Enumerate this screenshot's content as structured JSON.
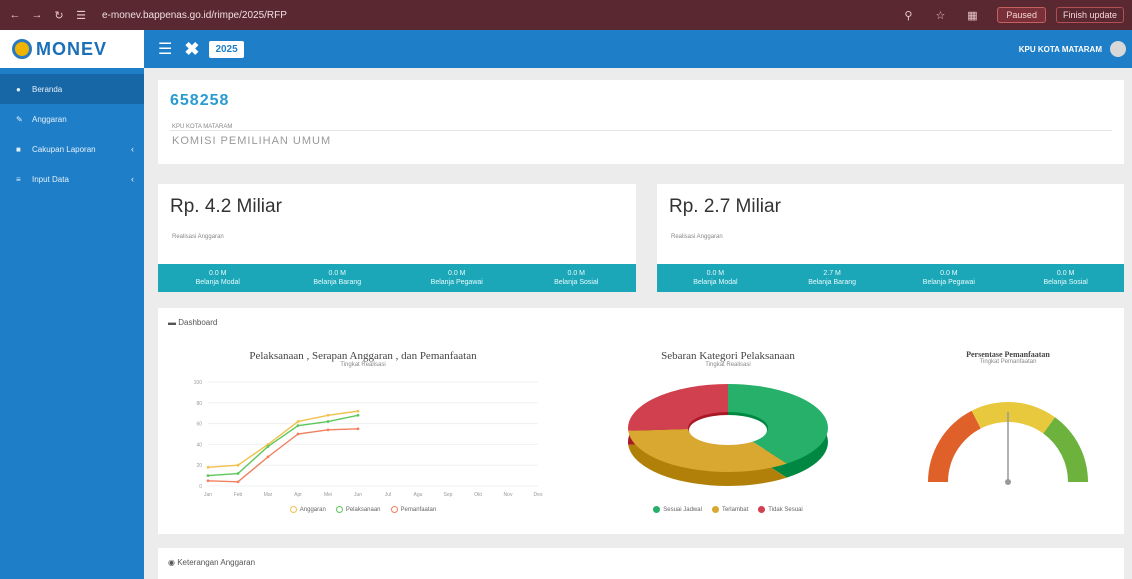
{
  "browser": {
    "url": "e-monev.bappenas.go.id/rimpe/2025/RFP",
    "pill1": "Paused",
    "pill2": "Finish update"
  },
  "app": {
    "logo_text": "MONEV",
    "year": "2025",
    "user": "KPU KOTA MATARAM"
  },
  "sidebar": {
    "items": [
      {
        "label": "Beranda",
        "icon": "home-icon",
        "active": true,
        "chevron": false
      },
      {
        "label": "Anggaran",
        "icon": "pencil-icon",
        "active": false,
        "chevron": false
      },
      {
        "label": "Cakupan Laporan",
        "icon": "folder-icon",
        "active": false,
        "chevron": true
      },
      {
        "label": "Input Data",
        "icon": "list-icon",
        "active": false,
        "chevron": true
      }
    ]
  },
  "header_card": {
    "code": "658258",
    "caption": "KPU KOTA MATARAM",
    "org": "KOMISI PEMILIHAN UMUM"
  },
  "budget_left": {
    "amount": "Rp. 4.2 Miliar",
    "caption": "Realisasi Anggaran",
    "cells": [
      {
        "value": "0.0 M",
        "label": "Belanja Modal"
      },
      {
        "value": "0.0 M",
        "label": "Belanja Barang"
      },
      {
        "value": "0.0 M",
        "label": "Belanja Pegawai"
      },
      {
        "value": "0.0 M",
        "label": "Belanja Sosial"
      }
    ]
  },
  "budget_right": {
    "amount": "Rp. 2.7 Miliar",
    "caption": "Realisasi Anggaran",
    "cells": [
      {
        "value": "0.0 M",
        "label": "Belanja Modal"
      },
      {
        "value": "2.7 M",
        "label": "Belanja Barang"
      },
      {
        "value": "0.0 M",
        "label": "Belanja Pegawai"
      },
      {
        "value": "0.0 M",
        "label": "Belanja Sosial"
      }
    ]
  },
  "dashboard": {
    "title": "Dashboard",
    "footer": "Keterangan Anggaran"
  },
  "chart_data": [
    {
      "type": "line",
      "title": "Pelaksanaan , Serapan Anggaran , dan Pemanfaatan",
      "subtitle": "Tingkat Realisasi",
      "categories": [
        "Jan",
        "Feb",
        "Mar",
        "Apr",
        "Mei",
        "Jun",
        "Jul",
        "Agu",
        "Sep",
        "Okt",
        "Nov",
        "Des"
      ],
      "ylim": [
        0,
        100
      ],
      "series": [
        {
          "name": "Anggaran",
          "color": "#f2c14e",
          "values": [
            18,
            20,
            40,
            62,
            68,
            72
          ]
        },
        {
          "name": "Pelaksanaan",
          "color": "#5dc75d",
          "values": [
            10,
            12,
            38,
            58,
            62,
            68
          ]
        },
        {
          "name": "Pemanfaatan",
          "color": "#f08060",
          "values": [
            5,
            4,
            28,
            50,
            54,
            55
          ]
        }
      ]
    },
    {
      "type": "pie",
      "title": "Sebaran Kategori Pelaksanaan",
      "subtitle": "Tingkat Realisasi",
      "slices": [
        {
          "name": "Sesuai Jadwal",
          "value": 40,
          "color": "#26b06a"
        },
        {
          "name": "Terlambat",
          "value": 34,
          "color": "#d9a830"
        },
        {
          "name": "Tidak Sesuai",
          "value": 26,
          "color": "#d0404e"
        }
      ]
    },
    {
      "type": "gauge",
      "title": "Persentase Pemanfaatan",
      "subtitle": "Tingkat Pemanfaatan",
      "value": 50,
      "min": 0,
      "max": 100
    }
  ]
}
